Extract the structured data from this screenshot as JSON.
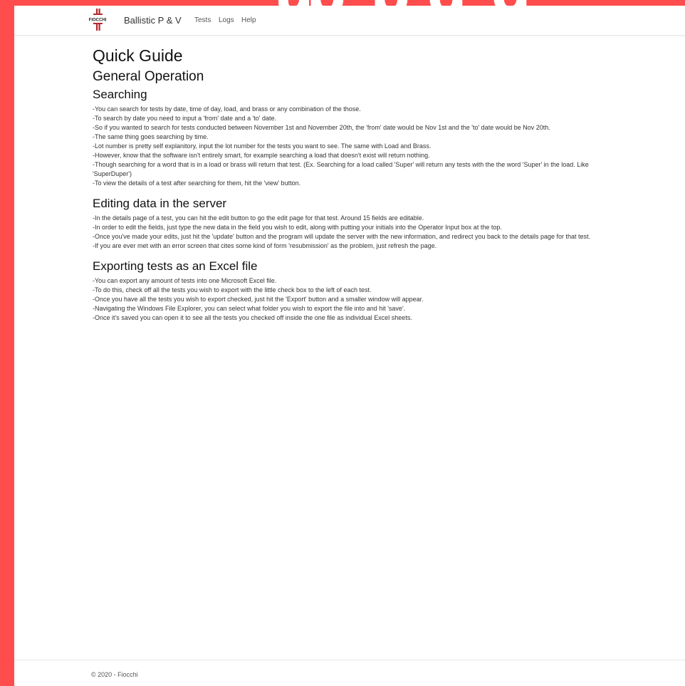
{
  "colors": {
    "background_frame": "#ff4d4d",
    "page": "#ffffff",
    "logo_red": "#b5282e"
  },
  "nav": {
    "logo_text": "FIOCCHI",
    "brand": "Ballistic P & V",
    "links": [
      "Tests",
      "Logs",
      "Help"
    ]
  },
  "page": {
    "title": "Quick Guide",
    "subtitle": "General Operation",
    "sections": [
      {
        "title": "Searching",
        "lines": [
          "-You can search for tests by date, time of day, load, and brass or any combination of the those.",
          "-To search by date you need to input a 'from' date and a 'to' date.",
          "-So if you wanted to search for tests conducted between November 1st and November 20th, the 'from' date would be Nov 1st and the 'to' date would be Nov 20th.",
          "-The same thing goes searching by time.",
          "-Lot number is pretty self explanitory, input the lot number for the tests you want to see. The same with Load and Brass.",
          "-However, know that the software isn't entirely smart, for example searching a load that doesn't exist will return nothing.",
          "-Though searching for a word that is in a load or brass will return that test. (Ex. Searching for a load called 'Super' will return any tests with the the word 'Super' in the load. Like 'SuperDuper')",
          "-To view the details of a test after searching for them, hit the 'view' button."
        ]
      },
      {
        "title": "Editing data in the server",
        "lines": [
          "-In the details page of a test, you can hit the edit button to go the edit page for that test. Around 15 fields are editable.",
          "-In order to edit the fields, just type the new data in the field you wish to edit, along with putting your initials into the Operator Input box at the top.",
          "-Once you've made your edits, just hit the 'update' button and the program will update the server with the new information, and redirect you back to the details page for that test.",
          "-If you are ever met with an error screen that cites some kind of form 'resubmission' as the problem, just refresh the page."
        ]
      },
      {
        "title": "Exporting tests as an Excel file",
        "lines": [
          "-You can export any amount of tests into one Microsoft Excel file.",
          "-To do this, check off all the tests you wish to export with the little check box to the left of each test.",
          "-Once you have all the tests you wish to export checked, just hit the 'Export' button and a smaller window will appear.",
          "-Navigating the Windows File Explorer, you can select what folder you wish to export the file into and hit 'save'.",
          "-Once it's saved you can open it to see all the tests you checked off inside the one file as individual Excel sheets."
        ]
      }
    ]
  },
  "footer": {
    "text": "© 2020 - Fiocchi"
  }
}
